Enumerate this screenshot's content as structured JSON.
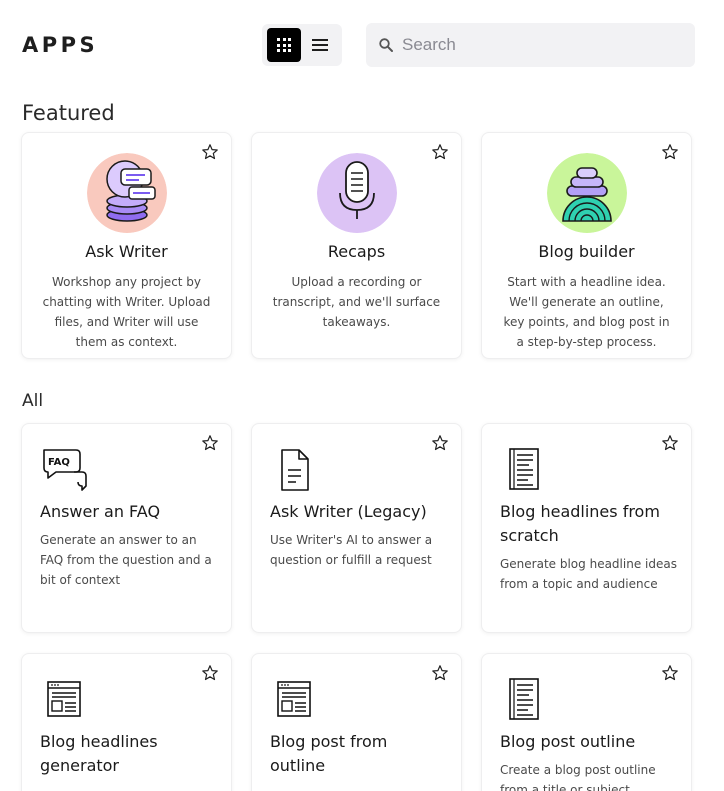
{
  "header": {
    "title": "APPS",
    "view_modes": [
      "grid",
      "list"
    ],
    "active_view": "grid",
    "search": {
      "placeholder": "Search",
      "value": ""
    }
  },
  "sections": {
    "featured_label": "Featured",
    "all_label": "All"
  },
  "featured": [
    {
      "title": "Ask Writer",
      "description": "Workshop any project by chatting with Writer. Upload files, and Writer will use them as context.",
      "icon": "ask-writer-chat-icon",
      "icon_bg": "#f9c9be"
    },
    {
      "title": "Recaps",
      "description": "Upload a recording or transcript, and we'll surface takeaways.",
      "icon": "microphone-icon",
      "icon_bg": "#dcc3f5"
    },
    {
      "title": "Blog builder",
      "description": "Start with a headline idea. We'll generate an outline, key points, and blog post in a step-by-step process.",
      "icon": "stacked-shapes-icon",
      "icon_bg": "#c9f59a"
    }
  ],
  "all_apps": [
    {
      "title": "Answer an FAQ",
      "description": "Generate an answer to an FAQ from the question and a bit of context",
      "icon": "faq-bubble-icon"
    },
    {
      "title": "Ask Writer (Legacy)",
      "description": "Use Writer's AI to answer a question or fulfill a request",
      "icon": "document-icon"
    },
    {
      "title": "Blog headlines from scratch",
      "description": "Generate blog headline ideas from a topic and audience",
      "icon": "text-page-icon"
    },
    {
      "title": "Blog headlines generator",
      "description": "",
      "icon": "browser-layout-icon"
    },
    {
      "title": "Blog post from outline",
      "description": "",
      "icon": "browser-layout-icon"
    },
    {
      "title": "Blog post outline",
      "description": "Create a blog post outline from a title or subject",
      "icon": "text-page-icon"
    }
  ],
  "colors": {
    "accent": "#000000",
    "control_bg": "#f2f2f4",
    "purple": "#7b5cf0",
    "teal": "#2fd1b0"
  }
}
